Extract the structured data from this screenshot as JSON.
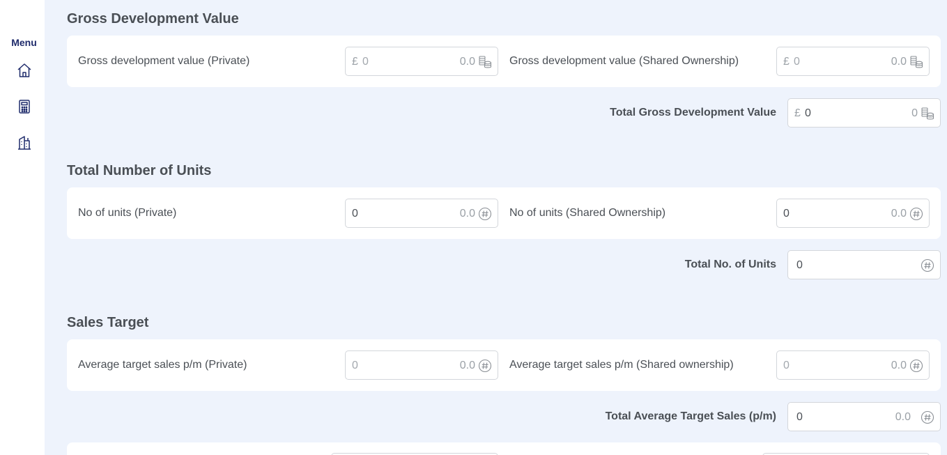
{
  "sidebar": {
    "menu_label": "Menu",
    "items": [
      {
        "name": "home-icon"
      },
      {
        "name": "calculator-icon"
      },
      {
        "name": "building-icon"
      }
    ]
  },
  "sections": {
    "gdv": {
      "title": "Gross Development Value",
      "private_label": "Gross development value (Private)",
      "private_prefix": "£",
      "private_value": "0",
      "private_hint": "0.0",
      "shared_label": "Gross development value (Shared Ownership)",
      "shared_prefix": "£",
      "shared_value": "0",
      "shared_hint": "0.0",
      "total_label": "Total Gross Development Value",
      "total_prefix": "£",
      "total_value": "0",
      "total_hint": "0",
      "unit_icon": "coins-icon"
    },
    "units": {
      "title": "Total Number of Units",
      "private_label": "No of units (Private)",
      "private_value": "0",
      "private_hint": "0.0",
      "shared_label": "No of units (Shared Ownership)",
      "shared_value": "0",
      "shared_hint": "0.0",
      "total_label": "Total No. of Units",
      "total_value": "0",
      "unit_icon": "hash-icon"
    },
    "sales": {
      "title": "Sales Target",
      "private_label": "Average target sales p/m (Private)",
      "private_value": "0",
      "private_hint": "0.0",
      "shared_label": "Average target sales p/m (Shared ownership)",
      "shared_value": "0",
      "shared_hint": "0.0",
      "total_label": "Total Average Target Sales (p/m)",
      "total_value": "0",
      "total_hint": "0.0",
      "unit_icon": "hash-icon"
    }
  },
  "colors": {
    "background": "#eef3fc",
    "card": "#ffffff",
    "menu_accent": "#1f2b6b",
    "text": "#4a4f55",
    "muted": "#9aa0a6"
  }
}
